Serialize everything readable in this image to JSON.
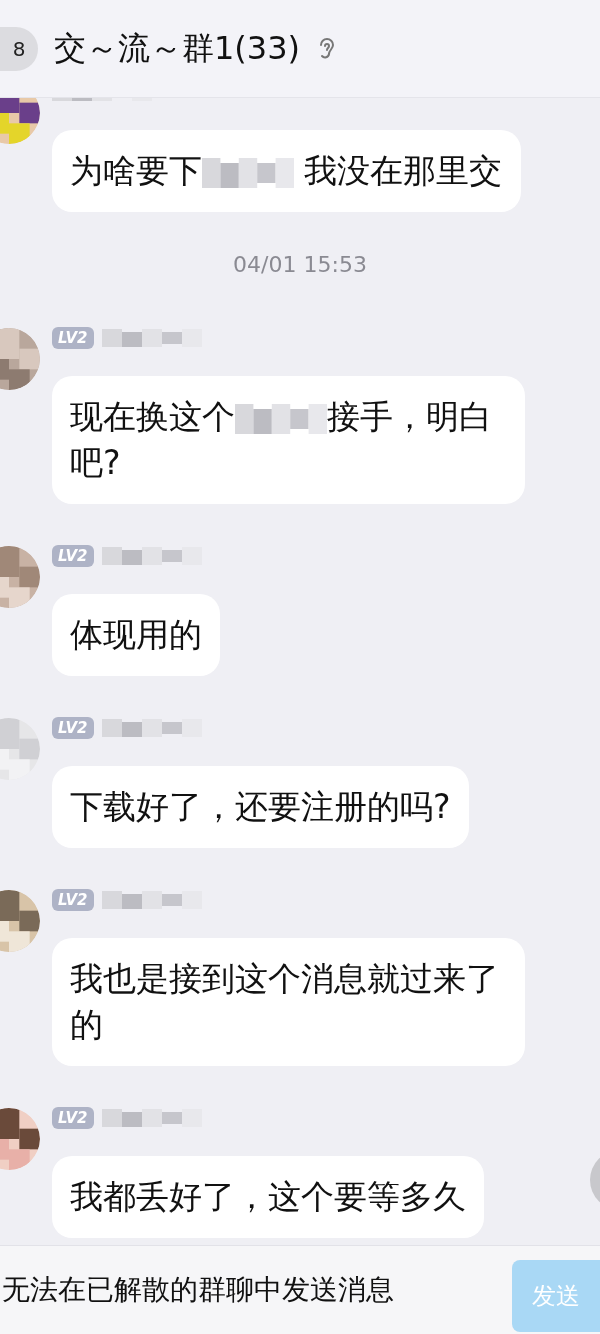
{
  "header": {
    "unread_count": "8",
    "title": "交～流～群1(33)"
  },
  "messages": [
    {
      "kind": "message",
      "segments": [
        {
          "kind": "text",
          "text": "为啥要下"
        },
        {
          "kind": "redacted"
        },
        {
          "kind": "text",
          "text": " 我没在那里交"
        }
      ]
    },
    {
      "kind": "time",
      "text": "04/01 15:53"
    },
    {
      "kind": "message",
      "level_badge": "LV2",
      "segments": [
        {
          "kind": "text",
          "text": "现在换这个"
        },
        {
          "kind": "redacted"
        },
        {
          "kind": "text",
          "text": "接手，明白吧?"
        }
      ]
    },
    {
      "kind": "message",
      "level_badge": "LV2",
      "segments": [
        {
          "kind": "text",
          "text": "体现用的"
        }
      ]
    },
    {
      "kind": "message",
      "level_badge": "LV2",
      "segments": [
        {
          "kind": "text",
          "text": "下载好了，还要注册的吗?"
        }
      ]
    },
    {
      "kind": "message",
      "level_badge": "LV2",
      "segments": [
        {
          "kind": "text",
          "text": "我也是接到这个消息就过来了的"
        }
      ]
    },
    {
      "kind": "message",
      "level_badge": "LV2",
      "segments": [
        {
          "kind": "text",
          "text": "我都丢好了，这个要等多久"
        }
      ]
    }
  ],
  "input_bar": {
    "notice": "无法在已解散的群聊中发送消息",
    "send_label": "发送",
    "disabled": true
  }
}
